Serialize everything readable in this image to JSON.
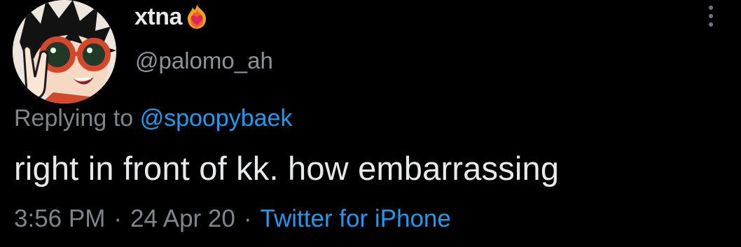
{
  "user": {
    "display_name": "xtna",
    "handle": "@palomo_ah",
    "name_emoji": "heart-on-fire-emoji"
  },
  "reply": {
    "prefix": "Replying to",
    "mention": "@spoopybaek"
  },
  "tweet": {
    "text": "right in front of kk. how embarrassing"
  },
  "meta": {
    "time": "3:56 PM",
    "separator": "·",
    "date": "24 Apr 20",
    "source": "Twitter for iPhone"
  },
  "colors": {
    "background": "#000000",
    "text": "#e7e9ea",
    "secondary_text": "#7e868c",
    "link": "#1d9bf0"
  },
  "icons": {
    "more": "more-dots-icon",
    "avatar": "avatar-image"
  }
}
